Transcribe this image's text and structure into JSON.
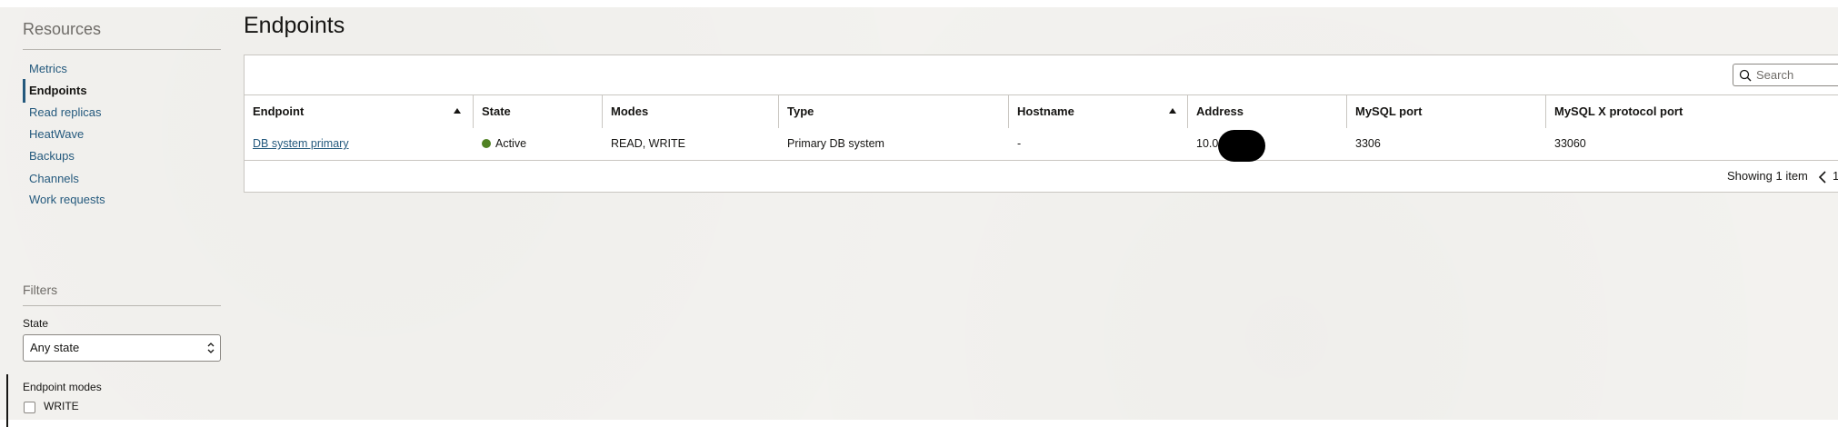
{
  "sidebar": {
    "title": "Resources",
    "items": [
      {
        "label": "Metrics"
      },
      {
        "label": "Endpoints"
      },
      {
        "label": "Read replicas"
      },
      {
        "label": "HeatWave"
      },
      {
        "label": "Backups"
      },
      {
        "label": "Channels"
      },
      {
        "label": "Work requests"
      }
    ],
    "active_item": "Endpoints",
    "filters": {
      "title": "Filters",
      "state_label": "State",
      "state_value": "Any state",
      "modes_label": "Endpoint modes",
      "modes_options": [
        {
          "label": "WRITE",
          "checked": false
        }
      ]
    }
  },
  "main": {
    "title": "Endpoints",
    "search": {
      "placeholder": "Search"
    },
    "table": {
      "columns": [
        "Endpoint",
        "State",
        "Modes",
        "Type",
        "Hostname",
        "Address",
        "MySQL port",
        "MySQL X protocol port"
      ],
      "rows": [
        {
          "endpoint": "DB system primary",
          "state": "Active",
          "modes": "READ, WRITE",
          "type": "Primary DB system",
          "hostname": "-",
          "address": "10.0",
          "mysql_port": "3306",
          "mysqlx_port": "33060"
        }
      ]
    },
    "footer": {
      "showing": "Showing 1 item",
      "page": "1"
    }
  },
  "colors": {
    "link": "#24597d",
    "status_active": "#508223",
    "border": "#c9c6c1"
  }
}
